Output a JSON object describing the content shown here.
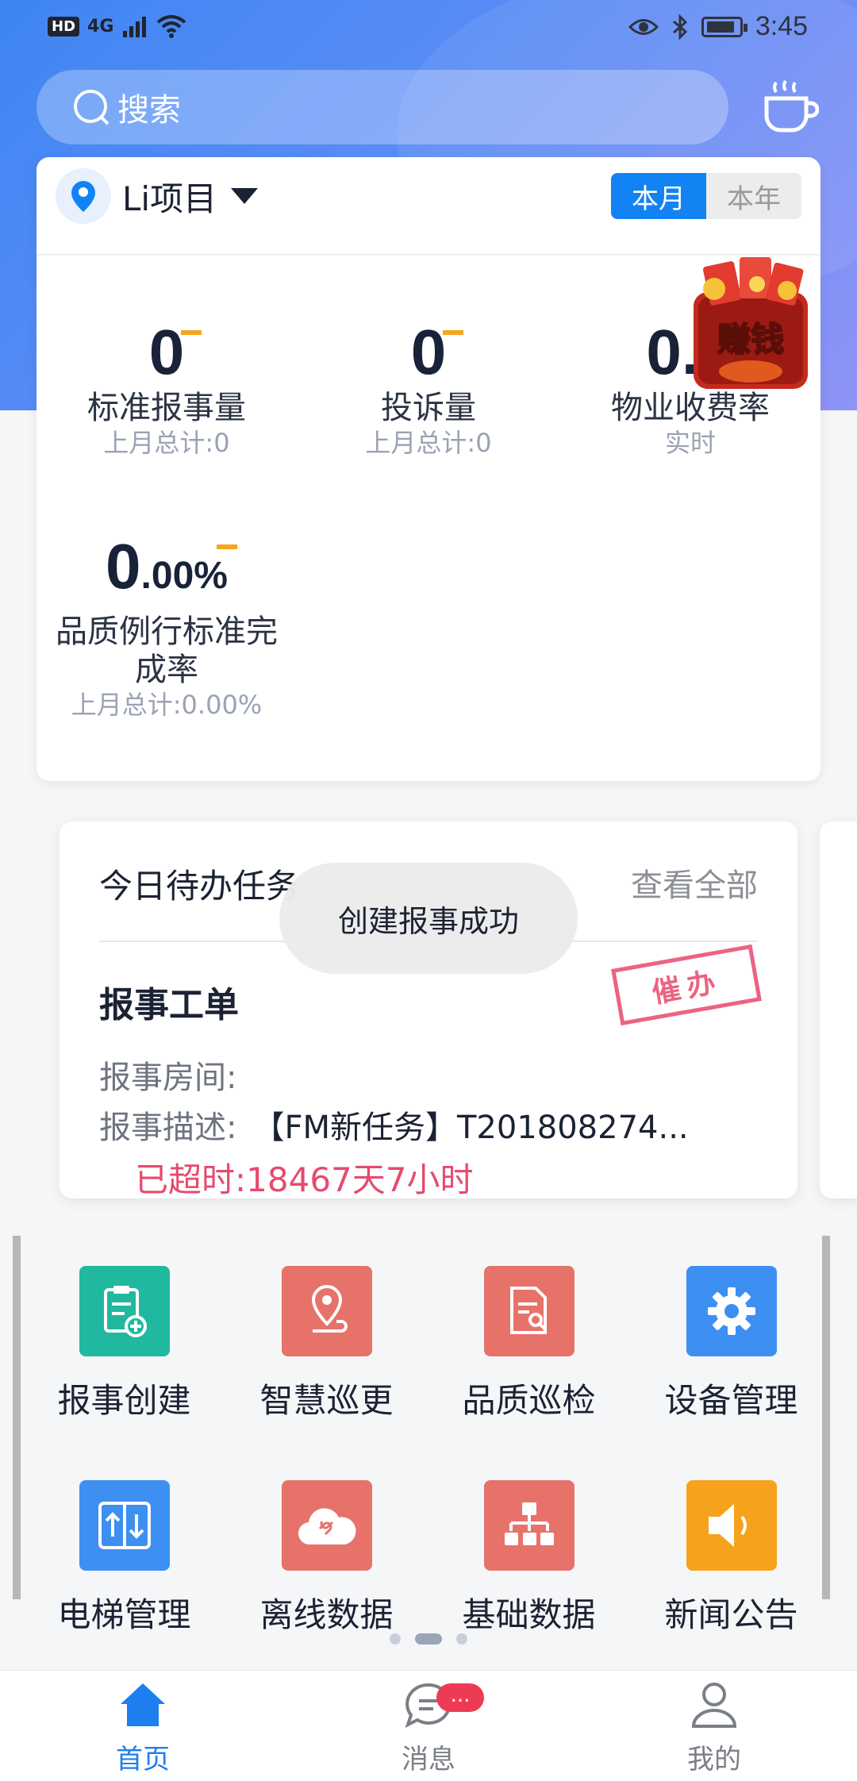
{
  "status_bar": {
    "hd": "HD",
    "network": "4G",
    "time": "3:45"
  },
  "search": {
    "placeholder": "搜索"
  },
  "project": {
    "name": "Li项目",
    "period_month": "本月",
    "period_year": "本年"
  },
  "stats": [
    {
      "value": "0",
      "label": "标准报事量",
      "sub": "上月总计:0"
    },
    {
      "value": "0",
      "label": "投诉量",
      "sub": "上月总计:0"
    },
    {
      "value": "0.0",
      "label": "物业收费率",
      "sub": "实时"
    },
    {
      "value": "0",
      "value_suffix": ".00%",
      "label": "品质例行标准完成率",
      "sub": "上月总计:0.00%"
    }
  ],
  "promo": {
    "label": "赚钱"
  },
  "todo": {
    "title": "今日待办任务",
    "view_all": "查看全部",
    "work_order": {
      "title": "报事工单",
      "stamp": "催办",
      "room_label": "报事房间:",
      "room_value": "",
      "desc_label": "报事描述:",
      "desc_value": "【FM新任务】T201808274...",
      "overdue": "已超时:18467天7小时"
    }
  },
  "toast": {
    "message": "创建报事成功"
  },
  "grid": [
    {
      "label": "报事创建",
      "icon": "report-create-icon",
      "color": "#20b9a0"
    },
    {
      "label": "智慧巡更",
      "icon": "location-patrol-icon",
      "color": "#e6726a"
    },
    {
      "label": "品质巡检",
      "icon": "quality-inspect-icon",
      "color": "#e6726a"
    },
    {
      "label": "设备管理",
      "icon": "gear-icon",
      "color": "#3d8ff2"
    },
    {
      "label": "电梯管理",
      "icon": "elevator-icon",
      "color": "#3d8ff2"
    },
    {
      "label": "离线数据",
      "icon": "cloud-offline-icon",
      "color": "#e6726a"
    },
    {
      "label": "基础数据",
      "icon": "hierarchy-icon",
      "color": "#e6726a"
    },
    {
      "label": "新闻公告",
      "icon": "speaker-icon",
      "color": "#f6a21c"
    }
  ],
  "tabs": [
    {
      "label": "首页",
      "icon": "home-icon"
    },
    {
      "label": "消息",
      "icon": "chat-icon",
      "badge": "..."
    },
    {
      "label": "我的",
      "icon": "user-icon"
    }
  ]
}
